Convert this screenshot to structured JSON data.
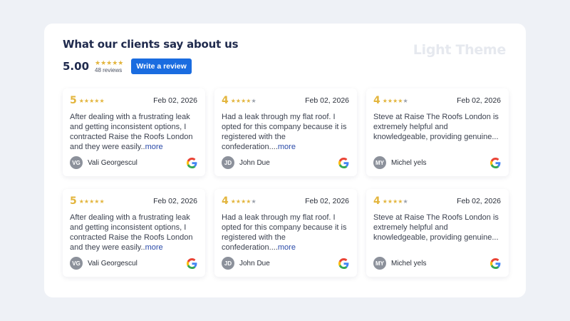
{
  "header": {
    "title": "What our clients say about us",
    "theme_label": "Light Theme"
  },
  "summary": {
    "score": "5.00",
    "stars": "★★★★★",
    "count": "48 reviews",
    "write_review_label": "Write a review"
  },
  "colors": {
    "star": "#e3b53d",
    "button": "#1a6ce0",
    "link": "#2a4aa8",
    "avatar": "#8c919b"
  },
  "reviews": [
    {
      "rating": "5",
      "stars_on": "★★★★★",
      "stars_off": "",
      "date": "Feb 02, 2026",
      "text": "After dealing with a frustrating leak and getting inconsistent options, I contracted Raise the Roofs London and they were easily..",
      "more": "more",
      "initials": "VG",
      "name": "Vali Georgescul",
      "source_icon": "google-icon"
    },
    {
      "rating": "4",
      "stars_on": "★★★★",
      "stars_off": "★",
      "date": "Feb 02, 2026",
      "text": "Had a leak through my flat roof. I opted for this company because it is registered with the confederation....",
      "more": "more",
      "initials": "JD",
      "name": "John Due",
      "source_icon": "google-icon"
    },
    {
      "rating": "4",
      "stars_on": "★★★★",
      "stars_off": "★",
      "date": "Feb 02, 2026",
      "text": "Steve at Raise The Roofs London is extremely helpful and knowledgeable, providing genuine...",
      "more": "",
      "initials": "MY",
      "name": "Michel yels",
      "source_icon": "google-icon"
    },
    {
      "rating": "5",
      "stars_on": "★★★★★",
      "stars_off": "",
      "date": "Feb 02, 2026",
      "text": "After dealing with a frustrating leak and getting inconsistent options, I contracted Raise the Roofs London and they were easily..",
      "more": "more",
      "initials": "VG",
      "name": "Vali Georgescul",
      "source_icon": "google-icon"
    },
    {
      "rating": "4",
      "stars_on": "★★★★",
      "stars_off": "★",
      "date": "Feb 02, 2026",
      "text": "Had a leak through my flat roof. I opted for this company because it is registered with the confederation....",
      "more": "more",
      "initials": "JD",
      "name": "John Due",
      "source_icon": "google-icon"
    },
    {
      "rating": "4",
      "stars_on": "★★★★",
      "stars_off": "★",
      "date": "Feb 02, 2026",
      "text": "Steve at Raise The Roofs London is extremely helpful and knowledgeable, providing genuine...",
      "more": "",
      "initials": "MY",
      "name": "Michel yels",
      "source_icon": "google-icon"
    }
  ]
}
